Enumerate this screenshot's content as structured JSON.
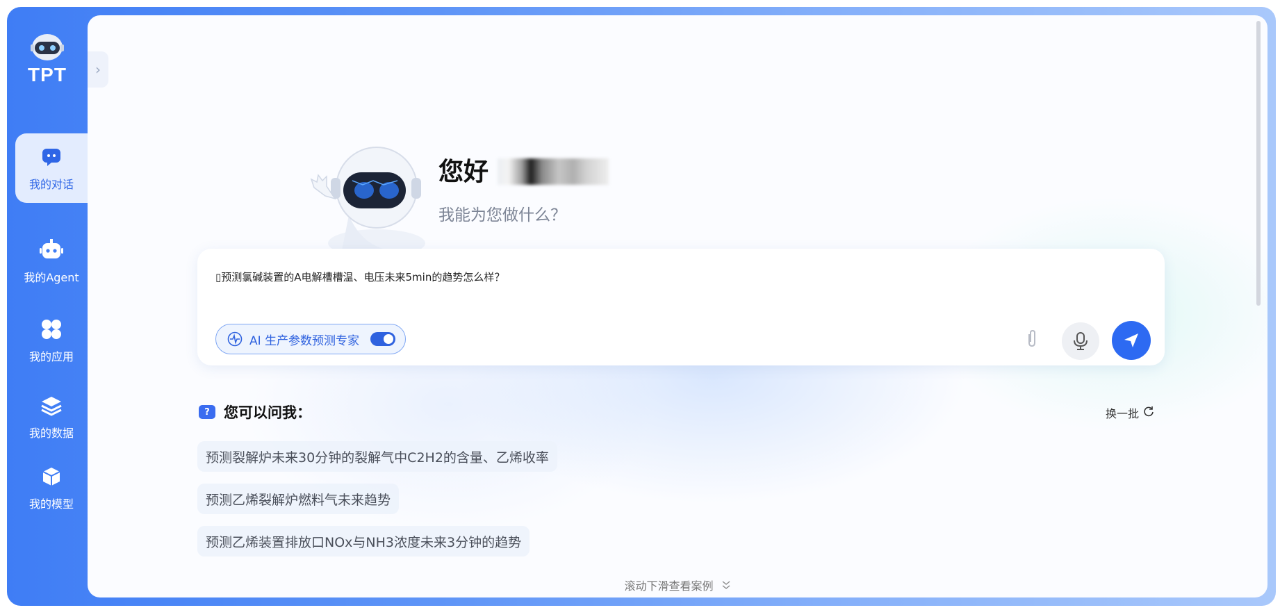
{
  "app": {
    "logo_text": "TPT"
  },
  "sidebar": {
    "items": [
      {
        "label": "我的对话",
        "icon": "chat-icon",
        "active": true
      },
      {
        "label": "我的Agent",
        "icon": "robot-icon",
        "active": false
      },
      {
        "label": "我的应用",
        "icon": "apps-icon",
        "active": false
      },
      {
        "label": "我的数据",
        "icon": "layers-icon",
        "active": false
      },
      {
        "label": "我的模型",
        "icon": "cube-icon",
        "active": false
      }
    ]
  },
  "greeting": {
    "title": "您好",
    "subtitle": "我能为您做什么？"
  },
  "input": {
    "value": "▯预测氯碱装置的A电解槽槽温、电压未来5min的趋势怎么样？",
    "expert_label": "AI 生产参数预测专家",
    "expert_enabled": true
  },
  "suggestions": {
    "heading": "您可以问我：",
    "refresh_label": "换一批",
    "items": [
      "预测裂解炉未来30分钟的裂解气中C2H2的含量、乙烯收率",
      "预测乙烯裂解炉燃料气未来趋势",
      "预测乙烯装置排放口NOx与NH3浓度未来3分钟的趋势"
    ]
  },
  "scroll_hint": "滚动下滑查看案例",
  "colors": {
    "accent": "#2d6af2",
    "sidebar": "#3f7df5",
    "active_bg": "#e3ecfe"
  }
}
